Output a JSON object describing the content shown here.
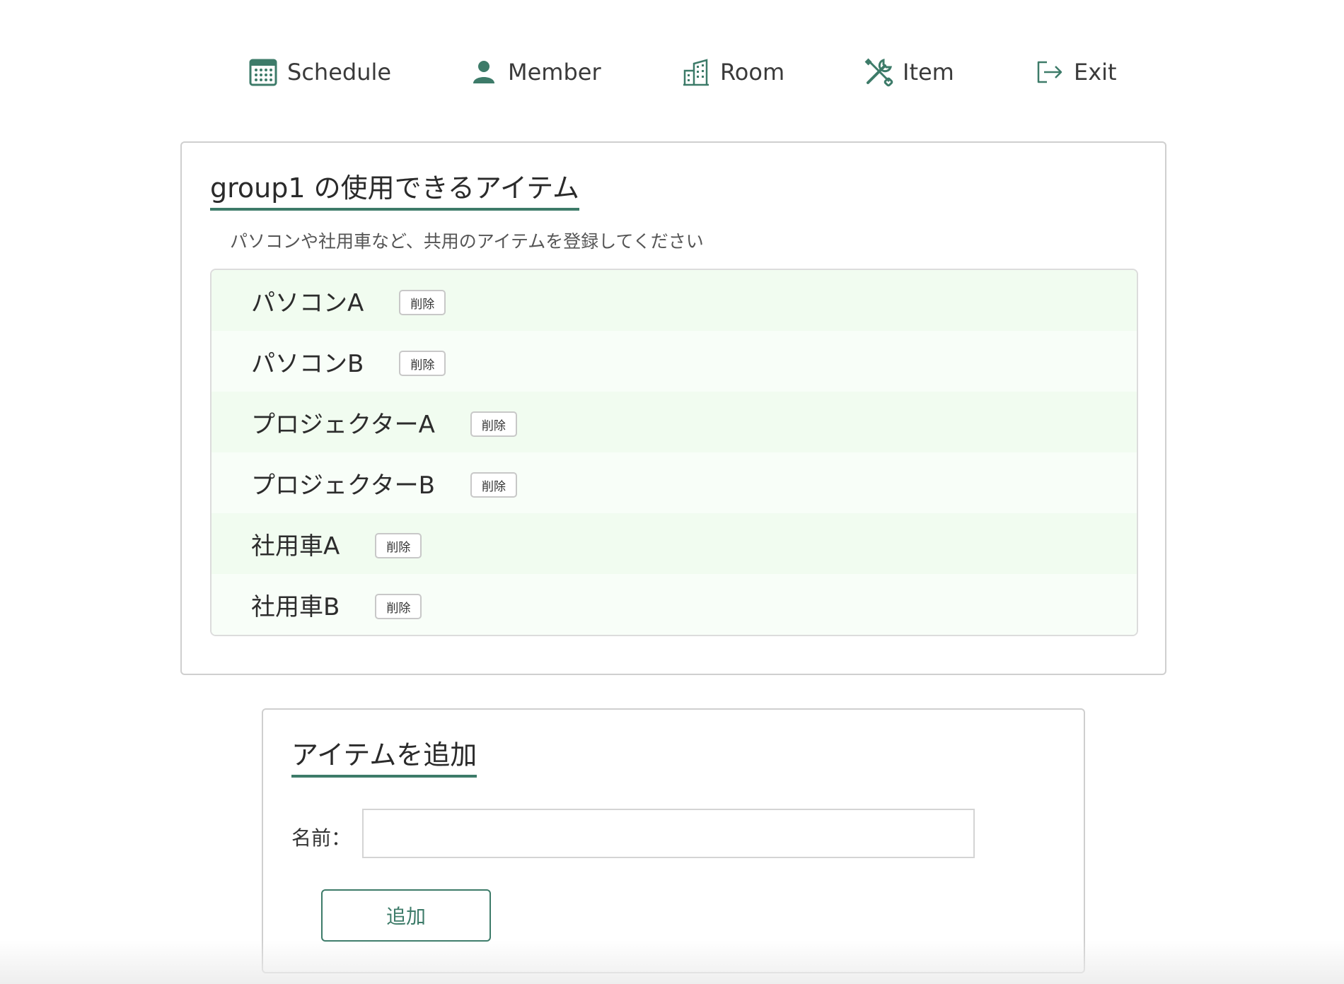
{
  "nav": {
    "items": [
      {
        "label": "Schedule",
        "icon": "calendar-icon"
      },
      {
        "label": "Member",
        "icon": "person-icon"
      },
      {
        "label": "Room",
        "icon": "building-icon"
      },
      {
        "label": "Item",
        "icon": "tools-icon"
      },
      {
        "label": "Exit",
        "icon": "exit-icon"
      }
    ]
  },
  "items_section": {
    "title": "group1 の使用できるアイテム",
    "subtitle": "パソコンや社用車など、共用のアイテムを登録してください",
    "delete_label": "削除",
    "items": [
      {
        "name": "パソコンA"
      },
      {
        "name": "パソコンB"
      },
      {
        "name": "プロジェクターA"
      },
      {
        "name": "プロジェクターB"
      },
      {
        "name": "社用車A"
      },
      {
        "name": "社用車B"
      }
    ]
  },
  "add_section": {
    "title": "アイテムを追加",
    "name_label": "名前：",
    "name_value": "",
    "submit_label": "追加"
  },
  "colors": {
    "accent": "#3d7b69",
    "row_odd": "#f1fcf0",
    "row_even": "#f8fef8",
    "border": "#cfcfcf"
  }
}
